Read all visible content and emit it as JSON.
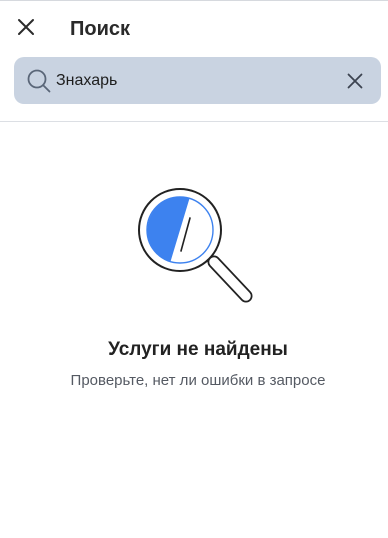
{
  "header": {
    "title": "Поиск",
    "close_icon": "close-icon"
  },
  "search": {
    "value": "Знахарь",
    "search_icon": "search-icon",
    "clear_icon": "clear-icon",
    "background_color": "#c9d3e1"
  },
  "empty_state": {
    "illustration": "magnifier-illustration",
    "title": "Услуги не найдены",
    "subtitle": "Проверьте, нет ли ошибки в запросе",
    "accent_color": "#3d82ef"
  }
}
